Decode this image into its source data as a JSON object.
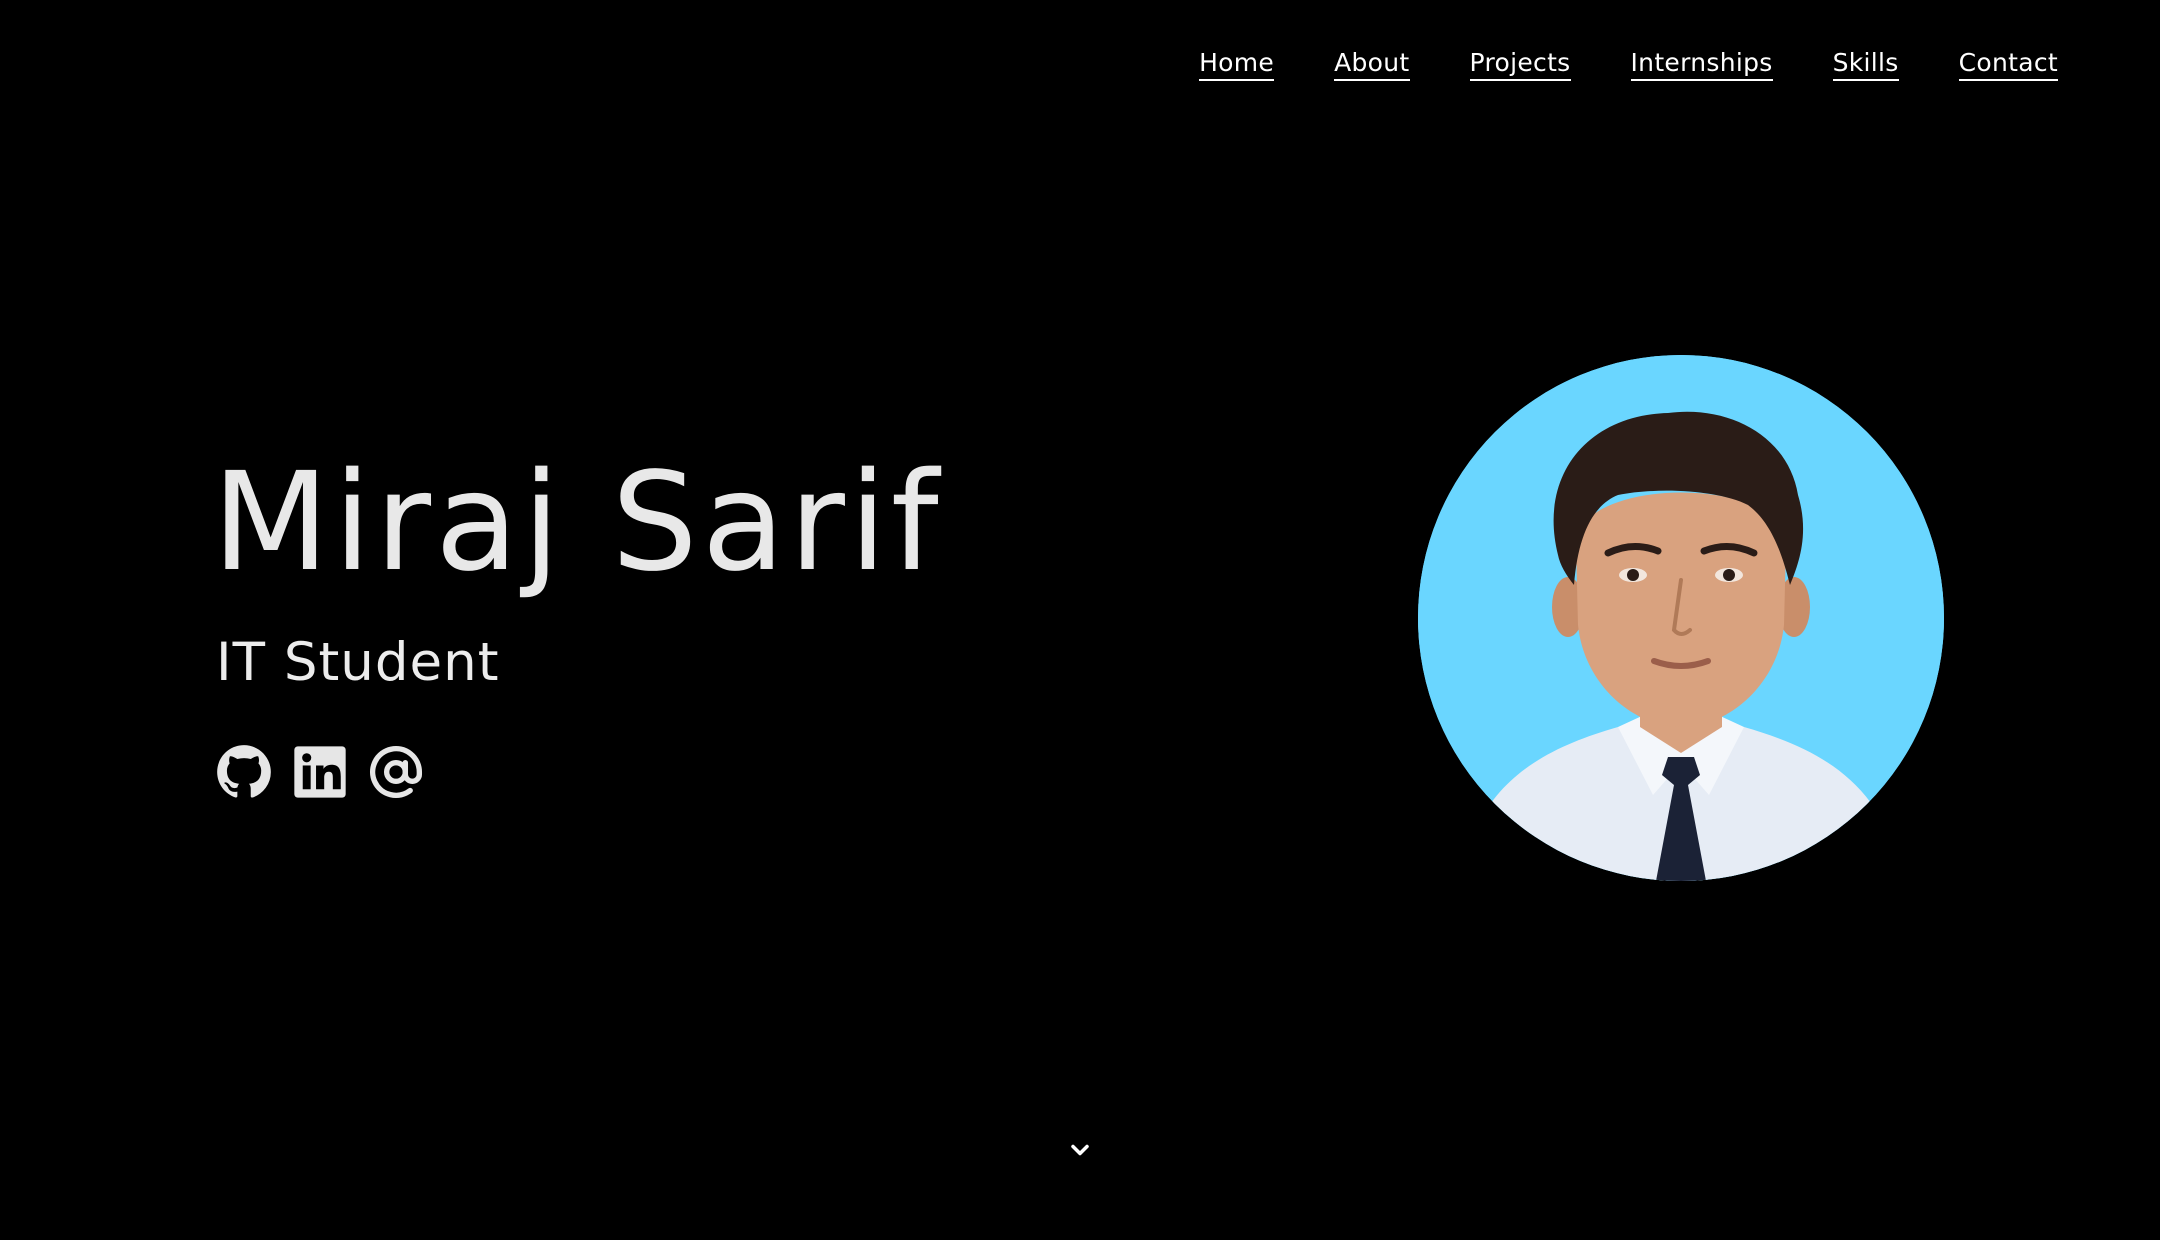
{
  "nav": {
    "items": [
      {
        "label": "Home"
      },
      {
        "label": "About"
      },
      {
        "label": "Projects"
      },
      {
        "label": "Internships"
      },
      {
        "label": "Skills"
      },
      {
        "label": "Contact"
      }
    ]
  },
  "hero": {
    "name": "Miraj Sarif",
    "role": "IT Student"
  },
  "social": {
    "icons": [
      "github-icon",
      "linkedin-icon",
      "at-sign-icon"
    ]
  },
  "avatar": {
    "icon": "profile-photo",
    "background_color": "#6ad6ff"
  },
  "scroll": {
    "icon": "chevron-down-icon"
  },
  "colors": {
    "background": "#000000",
    "text": "#e6e6e6",
    "nav_text": "#ffffff"
  }
}
